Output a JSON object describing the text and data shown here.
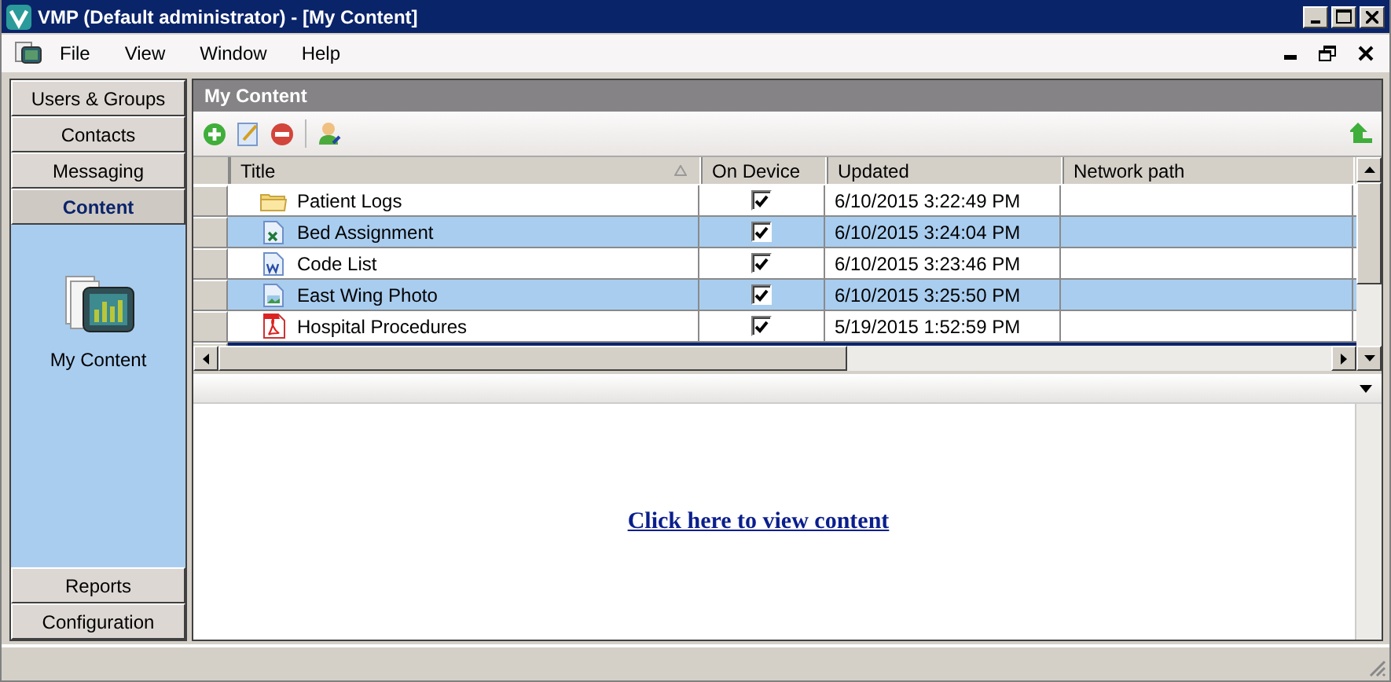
{
  "window": {
    "title": "VMP (Default administrator) - [My Content]"
  },
  "menu": [
    "File",
    "View",
    "Window",
    "Help"
  ],
  "sidebar": {
    "items": [
      {
        "label": "Users & Groups",
        "selected": false
      },
      {
        "label": "Contacts",
        "selected": false
      },
      {
        "label": "Messaging",
        "selected": false
      },
      {
        "label": "Content",
        "selected": true
      }
    ],
    "launcher": {
      "label": "My Content"
    },
    "bottom_items": [
      {
        "label": "Reports",
        "selected": false
      },
      {
        "label": "Configuration",
        "selected": false
      }
    ]
  },
  "panel": {
    "title": "My Content"
  },
  "table": {
    "columns": [
      "Title",
      "On Device",
      "Updated",
      "Network path"
    ],
    "rows": [
      {
        "kind": "folder",
        "title": "Patient Logs",
        "on_device": true,
        "updated": "6/10/2015 3:22:49 PM",
        "selected": false
      },
      {
        "kind": "spreadsheet",
        "title": "Bed Assignment",
        "on_device": true,
        "updated": "6/10/2015 3:24:04 PM",
        "selected": false
      },
      {
        "kind": "document",
        "title": "Code List",
        "on_device": true,
        "updated": "6/10/2015 3:23:46 PM",
        "selected": false
      },
      {
        "kind": "image",
        "title": "East Wing Photo",
        "on_device": true,
        "updated": "6/10/2015 3:25:50 PM",
        "selected": false
      },
      {
        "kind": "pdf",
        "title": "Hospital Procedures",
        "on_device": true,
        "updated": "5/19/2015 1:52:59 PM",
        "selected": false
      },
      {
        "kind": "partial",
        "selected": true
      }
    ]
  },
  "preview": {
    "link": "Click here to view content"
  }
}
